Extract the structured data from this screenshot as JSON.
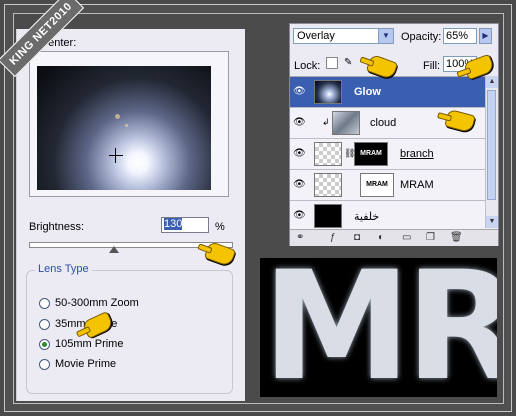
{
  "watermark": "KING NET2010",
  "lens_flare": {
    "flare_center_label": "e Center:",
    "brightness_label": "Brightness:",
    "brightness_value": "130",
    "brightness_unit": "%",
    "brightness_level_fraction": 0.43,
    "lens_type_title": "Lens Type",
    "lens_options": [
      {
        "label": "50-300mm Zoom",
        "checked": false
      },
      {
        "label": "35mm Prime",
        "checked": false
      },
      {
        "label": "105mm Prime",
        "checked": true
      },
      {
        "label": "Movie Prime",
        "checked": false
      }
    ]
  },
  "layers_panel": {
    "blend_mode": "Overlay",
    "opacity_label": "Opacity:",
    "opacity_value": "65%",
    "lock_label": "Lock:",
    "fill_label": "Fill:",
    "fill_value": "100%",
    "layers": [
      {
        "name": "Glow",
        "selected": true,
        "thumb": "glow"
      },
      {
        "name": "cloud",
        "selected": false,
        "thumb": "cloud"
      },
      {
        "name": "branch",
        "selected": false,
        "thumb": "mram"
      },
      {
        "name": "MRAM",
        "selected": false,
        "thumb": "mram-white"
      },
      {
        "name": "خلفية",
        "selected": false,
        "thumb": "dark"
      }
    ],
    "thumb_text": "MRAM"
  },
  "artwork_text": "MR"
}
